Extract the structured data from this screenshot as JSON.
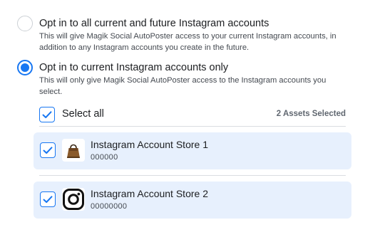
{
  "options": [
    {
      "title": "Opt in to all current and future Instagram accounts",
      "description": "This will give Magik Social AutoPoster access to your current Instagram accounts, in addition to any Instagram accounts you create in the future.",
      "selected": false
    },
    {
      "title": "Opt in to current Instagram accounts only",
      "description": "This will only give Magik Social AutoPoster access to the Instagram accounts you select.",
      "selected": true
    }
  ],
  "select_all": {
    "label": "Select all",
    "checked": true,
    "count": "2 Assets",
    "count_suffix": "Selected"
  },
  "accounts": [
    {
      "name": "Instagram Account Store 1",
      "id": "000000",
      "icon": "handbag-icon",
      "checked": true
    },
    {
      "name": "Instagram Account Store 2",
      "id": "00000000",
      "icon": "instagram-logo-icon",
      "checked": true
    }
  ],
  "colors": {
    "accent": "#1877f2",
    "row_bg": "#e7f0fd",
    "text": "#1c1e21",
    "muted": "#606770"
  }
}
